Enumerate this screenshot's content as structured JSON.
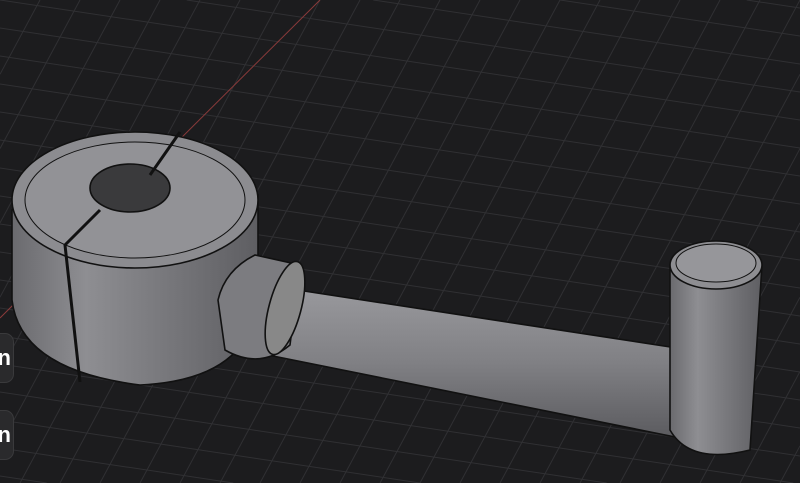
{
  "viewport": {
    "background": "#1c1c1e",
    "grid_color": "#333336",
    "axis_color": "#8a3a3a",
    "model_color": "#8a8a8e"
  },
  "side_buttons": [
    {
      "label": "n"
    },
    {
      "label": "n"
    }
  ]
}
